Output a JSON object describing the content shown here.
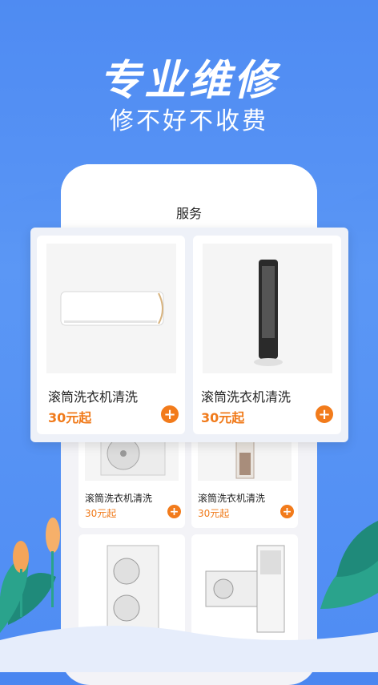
{
  "headline": "专业维修",
  "subline": "修不好不收费",
  "phone": {
    "header_title": "服务"
  },
  "featured_cards": [
    {
      "name": "滚筒洗衣机清洗",
      "price": "30元起",
      "icon": "air-conditioner-wall-image"
    },
    {
      "name": "滚筒洗衣机清洗",
      "price": "30元起",
      "icon": "tower-fan-image"
    }
  ],
  "grid_cards": [
    {
      "name": "滚筒洗衣机清洗",
      "price": "30元起",
      "icon": "ac-outdoor-unit-image"
    },
    {
      "name": "滚筒洗衣机清洗",
      "price": "30元起",
      "icon": "floor-standing-ac-image"
    },
    {
      "name": "",
      "price": "",
      "icon": "vrf-outdoor-unit-image"
    },
    {
      "name": "",
      "price": "",
      "icon": "ac-units-set-image"
    }
  ],
  "colors": {
    "accent": "#f27b1b",
    "background": "#4a86f0",
    "price": "#f07a1a"
  }
}
